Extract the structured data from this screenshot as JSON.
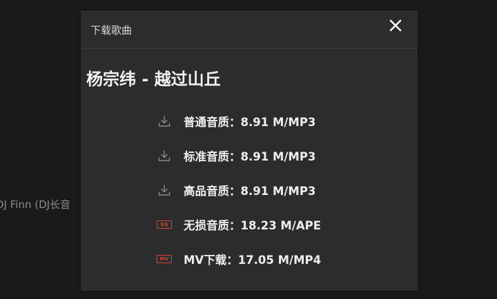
{
  "background": {
    "partial_text": "DJ Finn (DJ长音"
  },
  "dialog": {
    "title": "下载歌曲",
    "close_icon": "close-icon",
    "song_title": "杨宗纬 - 越过山丘",
    "options": [
      {
        "icon": "download-icon",
        "label": "普通音质：8.91 M/MP3"
      },
      {
        "icon": "download-icon",
        "label": "标准音质：8.91 M/MP3"
      },
      {
        "icon": "download-icon",
        "label": "高品音质：8.91 M/MP3"
      },
      {
        "icon": "sq-badge-icon",
        "badge": "SQ",
        "label": "无损音质：18.23 M/APE"
      },
      {
        "icon": "mv-badge-icon",
        "badge": "MV",
        "label": "MV下载：17.05 M/MP4"
      }
    ]
  },
  "colors": {
    "dialog_bg": "#2c2c2e",
    "page_bg": "#1a1a1b",
    "accent_red": "#d9452a",
    "text": "#eeeeee"
  }
}
